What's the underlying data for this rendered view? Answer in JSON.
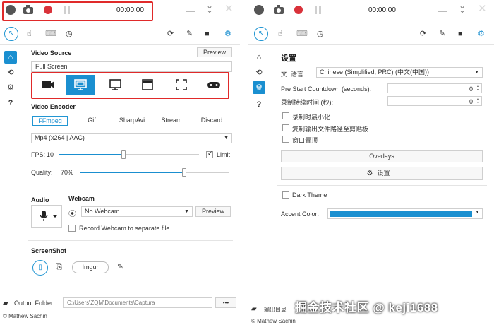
{
  "left": {
    "timer": "00:00:00",
    "sidebar": {
      "home": "⌂",
      "history": "⟲",
      "settings": "⚙",
      "help": "?"
    },
    "video_source": {
      "label": "Video Source",
      "preview_label": "Preview",
      "current": "Full Screen",
      "source_icons": [
        "camera-icon",
        "screen-icon",
        "monitor-icon",
        "window-icon",
        "region-icon",
        "gamepad-icon"
      ]
    },
    "video_encoder": {
      "label": "Video Encoder",
      "tabs": [
        "FFmpeg",
        "Gif",
        "SharpAvi",
        "Stream",
        "Discard"
      ],
      "selected_tab": "FFmpeg",
      "format": "Mp4 (x264 | AAC)",
      "fps_label": "FPS:",
      "fps_value": "10",
      "fps_fraction": 0.46,
      "limit_label": "Limit",
      "limit_checked": true,
      "quality_label": "Quality:",
      "quality_value": "70%",
      "quality_fraction": 0.7
    },
    "audio": {
      "label": "Audio"
    },
    "webcam": {
      "label": "Webcam",
      "selected": "No Webcam",
      "preview_label": "Preview",
      "separate_file_label": "Record Webcam to separate file"
    },
    "screenshot": {
      "label": "ScreenShot",
      "imgur_label": "Imgur"
    },
    "output_folder": {
      "label": "Output Folder",
      "path": "C:\\Users\\ZQM\\Documents\\Captura",
      "more_label": "•••"
    },
    "copyright": "© Mathew Sachin"
  },
  "right": {
    "timer": "00:00:00",
    "sidebar": {
      "home": "⌂",
      "history": "⟲",
      "settings": "⚙",
      "help": "?"
    },
    "settings": {
      "title": "设置",
      "language_label": "语言:",
      "language_value": "Chinese (Simplified, PRC) (中文(中国))",
      "pre_start_label": "Pre Start Countdown (seconds):",
      "pre_start_value": "0",
      "duration_label": "录制持续时间 (秒):",
      "duration_value": "0",
      "minimize_label": "录制时最小化",
      "copy_path_label": "复制输出文件路径至剪贴板",
      "topmost_label": "窗口置顶",
      "overlays_label": "Overlays",
      "settings_button_label": "设置 ...",
      "dark_theme_label": "Dark Theme",
      "accent_label": "Accent Color:",
      "accent_color": "#1a8fd0"
    },
    "output_folder": {
      "label": "输出目录"
    },
    "copyright": "© Mathew Sachin"
  },
  "watermark": "掘金技术社区 @ keji1688"
}
